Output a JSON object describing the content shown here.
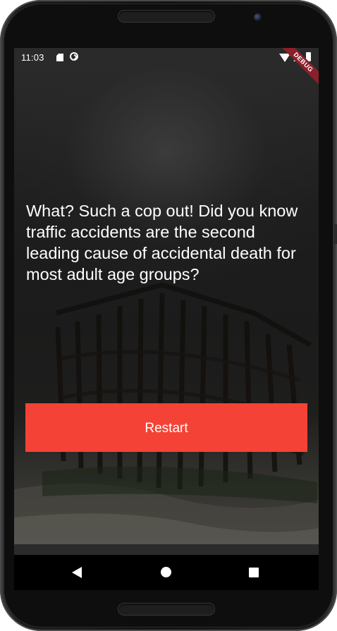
{
  "status_bar": {
    "time": "11:03",
    "icons": [
      "sd-card-icon",
      "sync-icon",
      "wifi-icon",
      "signal-icon",
      "battery-icon"
    ]
  },
  "debug_banner": "DEBUG",
  "story": {
    "text": "What? Such a cop out! Did you know traffic accidents are the second leading cause of accidental death for most adult age groups?"
  },
  "actions": {
    "restart_label": "Restart"
  },
  "nav_bar": {
    "icons": [
      "back-icon",
      "home-icon",
      "recents-icon"
    ]
  },
  "colors": {
    "accent": "#f44336",
    "text": "#ffffff",
    "status_bar": "#2a2a2a",
    "nav_bar": "#000000"
  }
}
